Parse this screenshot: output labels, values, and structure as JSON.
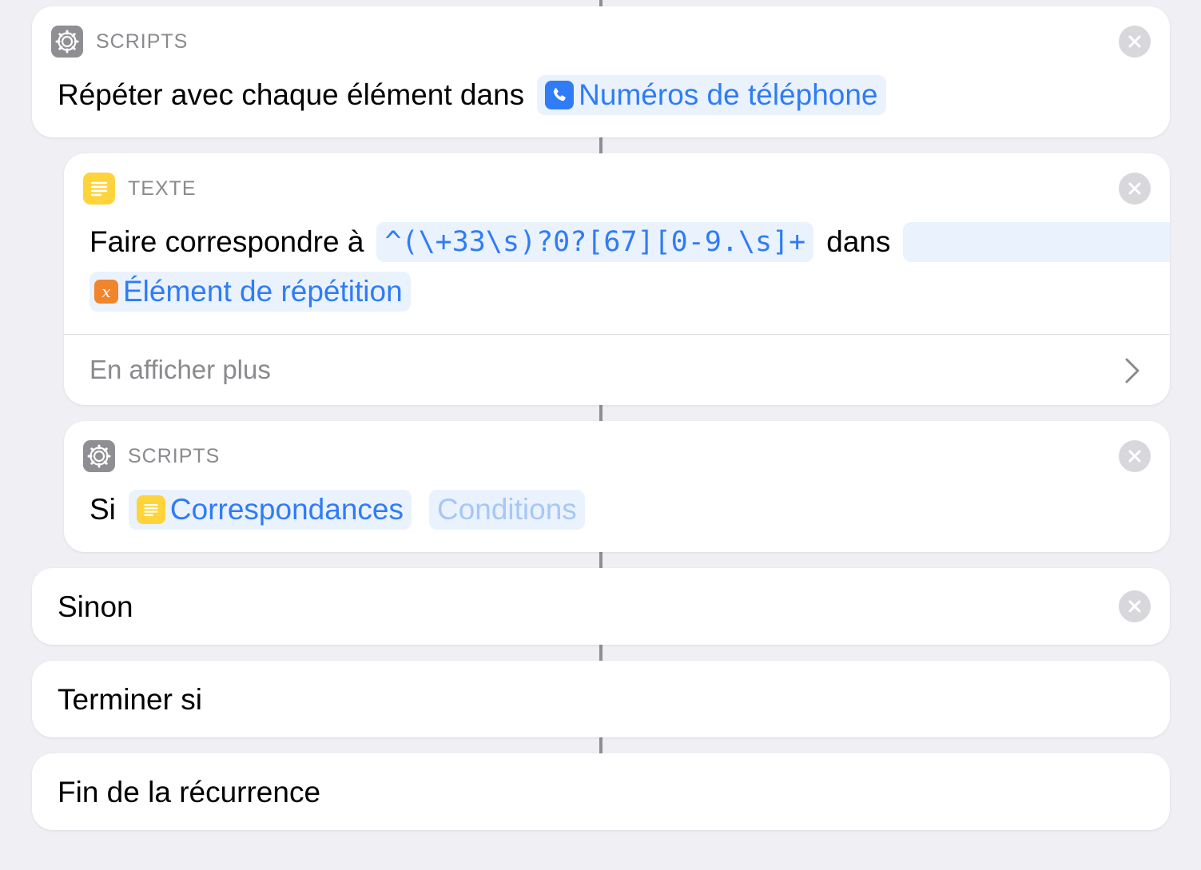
{
  "repeat_card": {
    "category": "SCRIPTS",
    "prefix": "Répéter avec chaque élément dans",
    "variable": "Numéros de téléphone"
  },
  "match_card": {
    "category": "TEXTE",
    "prefix": "Faire correspondre à",
    "pattern": "^(\\+33\\s)?0?[67][0-9.\\s]+",
    "middle": "dans",
    "input": "Élément de répétition",
    "input_icon_glyph": "x",
    "show_more": "En afficher plus"
  },
  "if_card": {
    "category": "SCRIPTS",
    "prefix": "Si",
    "variable": "Correspondances",
    "conditions": "Conditions"
  },
  "otherwise_card": {
    "label": "Sinon"
  },
  "end_if_card": {
    "label": "Terminer si"
  },
  "end_repeat_card": {
    "label": "Fin de la récurrence"
  },
  "icons": {
    "scripts": "gear-icon",
    "text": "text-lines-icon",
    "phone": "phone-icon",
    "variable": "variable-x-icon",
    "close": "close-icon",
    "chevron": "chevron-right-icon"
  },
  "colors": {
    "background": "#efeff4",
    "card": "#ffffff",
    "accent_blue": "#2f7cf6",
    "token_bg": "#eaf2fd",
    "scripts_gray": "#8e8e93",
    "text_yellow": "#ffd43b",
    "variable_orange": "#f0852b"
  }
}
